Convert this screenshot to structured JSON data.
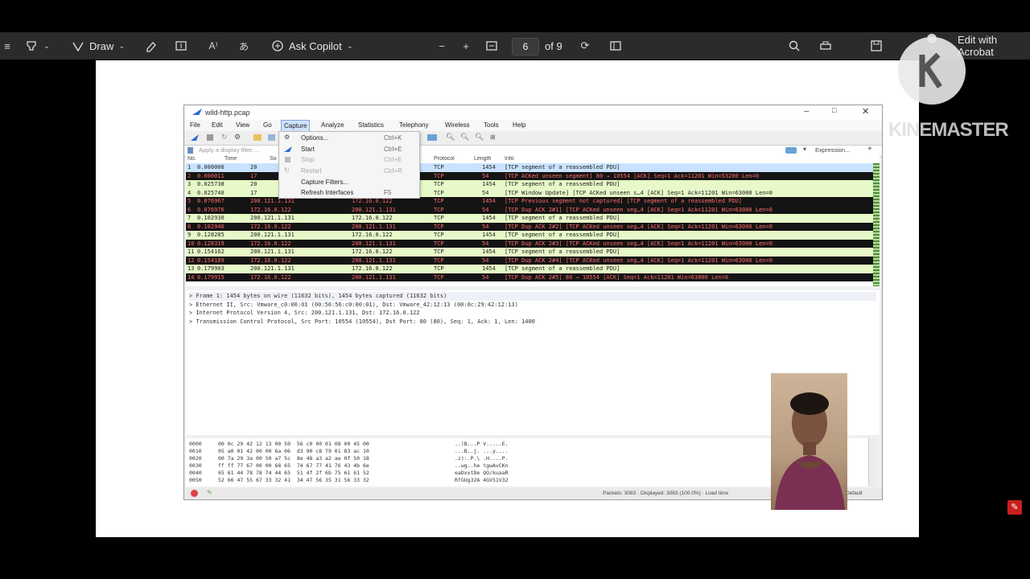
{
  "toolbar": {
    "draw_label": "Draw",
    "ask_copilot_label": "Ask Copilot",
    "page_number": "6",
    "page_total": "of 9",
    "edit_label": "Edit with Acrobat"
  },
  "watermark": {
    "text": "KINEMASTER"
  },
  "wireshark": {
    "title": "wild-http.pcap",
    "menu": [
      "File",
      "Edit",
      "View",
      "Go",
      "Capture",
      "Analyze",
      "Statistics",
      "Telephony",
      "Wireless",
      "Tools",
      "Help"
    ],
    "filter_placeholder": "Apply a display filter ...",
    "expression_label": "Expression...",
    "columns": [
      "No.",
      "Time",
      "So",
      "Protocol",
      "Length",
      "Info"
    ],
    "capture_menu": [
      {
        "label": "Options...",
        "shortcut": "Ctrl+K",
        "enabled": true
      },
      {
        "label": "Start",
        "shortcut": "Ctrl+E",
        "enabled": true
      },
      {
        "label": "Stop",
        "shortcut": "Ctrl+E",
        "enabled": false
      },
      {
        "label": "Restart",
        "shortcut": "Ctrl+R",
        "enabled": false
      },
      {
        "label": "Capture Filters...",
        "shortcut": "",
        "enabled": true
      },
      {
        "label": "Refresh Interfaces",
        "shortcut": "F5",
        "enabled": true
      }
    ],
    "packets": [
      {
        "no": "1",
        "time": "0.000000",
        "src": "20",
        "dst": "",
        "proto": "TCP",
        "len": "1454",
        "info": "[TCP segment of a reassembled PDU]",
        "style": "light"
      },
      {
        "no": "2",
        "time": "0.000011",
        "src": "17",
        "dst": "",
        "proto": "TCP",
        "len": "54",
        "info": "[TCP ACKed unseen segment] 80 → 10554 [ACK] Seq=1 Ack=11201 Win=53200 Len=0",
        "style": "dark"
      },
      {
        "no": "3",
        "time": "0.025738",
        "src": "20",
        "dst": "",
        "proto": "TCP",
        "len": "1454",
        "info": "[TCP segment of a reassembled PDU]",
        "style": "light"
      },
      {
        "no": "4",
        "time": "0.025740",
        "src": "17",
        "dst": "",
        "proto": "TCP",
        "len": "54",
        "info": "[TCP Window Update] [TCP ACKed unseen s…4 [ACK] Seq=1 Ack=11201 Win=63000 Len=0",
        "style": "light"
      },
      {
        "no": "5",
        "time": "0.076967",
        "src": "200.121.1.131",
        "dst": "172.16.0.122",
        "proto": "TCP",
        "len": "1454",
        "info": "[TCP Previous segment not captured] [TCP segment of a reassembled PDU]",
        "style": "dark"
      },
      {
        "no": "6",
        "time": "0.076976",
        "src": "172.16.0.122",
        "dst": "200.121.1.131",
        "proto": "TCP",
        "len": "54",
        "info": "[TCP Dup ACK 2#1] [TCP ACKed unseen seg…4 [ACK] Seq=1 Ack=11201 Win=63000 Len=0",
        "style": "dark"
      },
      {
        "no": "7",
        "time": "0.102930",
        "src": "200.121.1.131",
        "dst": "172.16.0.122",
        "proto": "TCP",
        "len": "1454",
        "info": "[TCP segment of a reassembled PDU]",
        "style": "light"
      },
      {
        "no": "8",
        "time": "0.102946",
        "src": "172.16.0.122",
        "dst": "200.121.1.131",
        "proto": "TCP",
        "len": "54",
        "info": "[TCP Dup ACK 2#2] [TCP ACKed unseen seg…4 [ACK] Seq=1 Ack=11201 Win=63000 Len=0",
        "style": "dark"
      },
      {
        "no": "9",
        "time": "0.128285",
        "src": "200.121.1.131",
        "dst": "172.16.0.122",
        "proto": "TCP",
        "len": "1454",
        "info": "[TCP segment of a reassembled PDU]",
        "style": "light"
      },
      {
        "no": "10",
        "time": "0.128319",
        "src": "172.16.0.122",
        "dst": "200.121.1.131",
        "proto": "TCP",
        "len": "54",
        "info": "[TCP Dup ACK 2#3] [TCP ACKed unseen seg…4 [ACK] Seq=1 Ack=11201 Win=63000 Len=0",
        "style": "dark"
      },
      {
        "no": "11",
        "time": "0.154162",
        "src": "200.121.1.131",
        "dst": "172.16.0.122",
        "proto": "TCP",
        "len": "1454",
        "info": "[TCP segment of a reassembled PDU]",
        "style": "light"
      },
      {
        "no": "12",
        "time": "0.154189",
        "src": "172.16.0.122",
        "dst": "200.121.1.131",
        "proto": "TCP",
        "len": "54",
        "info": "[TCP Dup ACK 2#4] [TCP ACKed unseen seg…4 [ACK] Seq=1 Ack=11201 Win=63000 Len=0",
        "style": "dark"
      },
      {
        "no": "13",
        "time": "0.179903",
        "src": "200.121.1.131",
        "dst": "172.16.0.122",
        "proto": "TCP",
        "len": "1454",
        "info": "[TCP segment of a reassembled PDU]",
        "style": "light"
      },
      {
        "no": "14",
        "time": "0.179915",
        "src": "172.16.0.122",
        "dst": "200.121.1.131",
        "proto": "TCP",
        "len": "54",
        "info": "[TCP Dup ACK 2#5] 80 → 10554 [ACK] Seq=1 Ack=11201 Win=63000 Len=0",
        "style": "dark"
      }
    ],
    "details": [
      "Frame 1: 1454 bytes on wire (11632 bits), 1454 bytes captured (11632 bits)",
      "Ethernet II, Src: Vmware_c0:00:01 (00:50:56:c0:00:01), Dst: Vmware_42:12:13 (00:0c:29:42:12:13)",
      "Internet Protocol Version 4, Src: 200.121.1.131, Dst: 172.16.0.122",
      "Transmission Control Protocol, Src Port: 10554 (10554), Dst Port: 80 (80), Seq: 1, Ack: 1, Len: 1400"
    ],
    "bytes": [
      {
        "off": "0000",
        "hex": "00 0c 29 42 12 13 00 50  56 c0 00 01 08 00 45 00",
        "ascii": "..)B...P V.....E."
      },
      {
        "off": "0010",
        "hex": "05 a0 01 42 00 00 6a 06  d3 90 c8 79 01 83 ac 10",
        "ascii": "...B..j. ...y...."
      },
      {
        "off": "0020",
        "hex": "00 7a 29 3a 00 50 a7 5c  8e 48 a3 a2 ae 0f 50 18",
        "ascii": ".z):.P.\\ .H....P."
      },
      {
        "off": "0030",
        "hex": "ff ff 77 67 00 00 68 65  74 67 77 41 76 43 4b 6e",
        "ascii": "..wg..he tgwAvCKn"
      },
      {
        "off": "0040",
        "hex": "65 61 44 78 78 74 44 65  51 4f 2f 6b 75 61 61 52",
        "ascii": "eaDxxtDe QO/kuaaR"
      },
      {
        "off": "0050",
        "hex": "52 66 47 55 67 33 32 41  34 47 56 35 31 56 33 32",
        "ascii": "RfGUg32A 4GV51V32"
      }
    ],
    "status_packets": "Packets: 3083 · Displayed: 3083 (100.0%) · Load time",
    "status_profile": "Default"
  },
  "colors": {
    "light_row": "#e7f9c8",
    "dark_row": "#141414",
    "dark_text": "#ff6a6a",
    "selected": "#c9e2ff"
  }
}
